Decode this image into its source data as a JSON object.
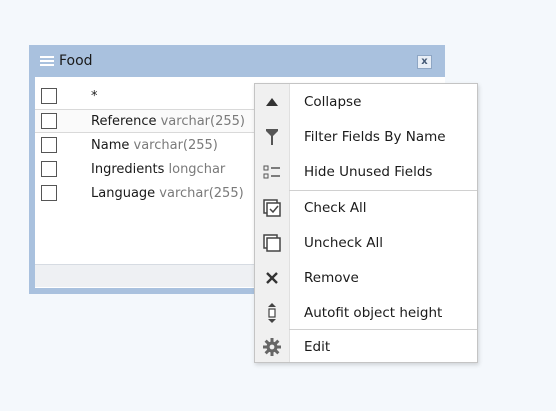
{
  "table": {
    "title": "Food",
    "close_label": "x",
    "fields": [
      {
        "name": "*",
        "type": ""
      },
      {
        "name": "Reference",
        "type": "varchar(255)"
      },
      {
        "name": "Name",
        "type": "varchar(255)"
      },
      {
        "name": "Ingredients",
        "type": "longchar"
      },
      {
        "name": "Language",
        "type": "varchar(255)"
      }
    ]
  },
  "context_menu": {
    "items": [
      {
        "label": "Collapse",
        "icon": "triangle-up-icon"
      },
      {
        "label": "Filter Fields By Name",
        "icon": "filter-icon"
      },
      {
        "label": "Hide Unused Fields",
        "icon": "hide-fields-icon"
      },
      {
        "label": "Check All",
        "icon": "check-all-icon"
      },
      {
        "label": "Uncheck All",
        "icon": "uncheck-all-icon"
      },
      {
        "label": "Remove",
        "icon": "remove-icon"
      },
      {
        "label": "Autofit object height",
        "icon": "autofit-icon"
      },
      {
        "label": "Edit",
        "icon": "gear-icon"
      }
    ]
  }
}
